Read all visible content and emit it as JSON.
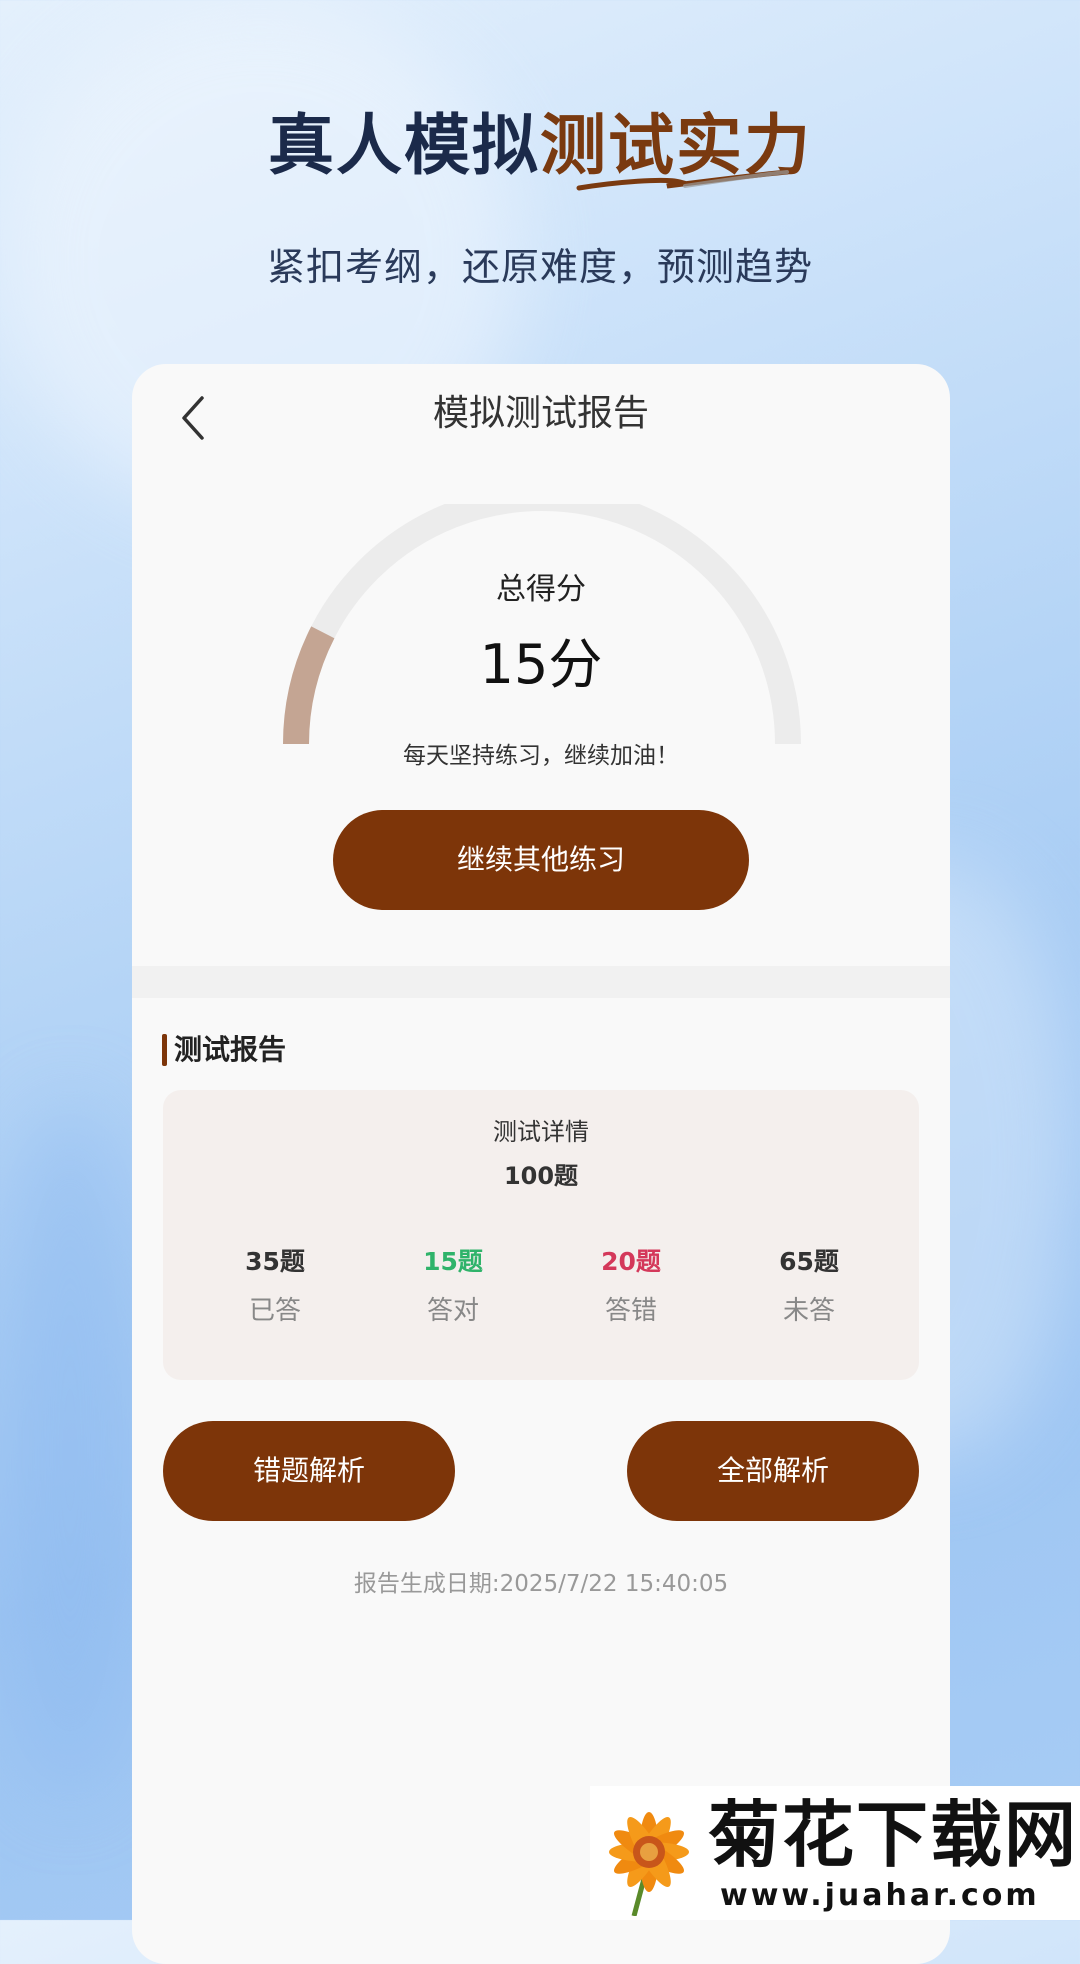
{
  "hero": {
    "title_part1": "真人模拟",
    "title_part2": "测试实力",
    "subtitle": "紧扣考纲，还原难度，预测趋势"
  },
  "nav": {
    "title": "模拟测试报告"
  },
  "score": {
    "label": "总得分",
    "value": "15分",
    "encourage": "每天坚持练习，继续加油！",
    "fraction": 0.15
  },
  "buttons": {
    "continue": "继续其他练习",
    "wrong_analysis": "错题解析",
    "all_analysis": "全部解析"
  },
  "report": {
    "section_title": "测试报告",
    "detail_label": "测试详情",
    "total": "100题",
    "stats": [
      {
        "value": "35题",
        "label": "已答",
        "color": "#333333"
      },
      {
        "value": "15题",
        "label": "答对",
        "color": "#2fb36a"
      },
      {
        "value": "20题",
        "label": "答错",
        "color": "#d4385a"
      },
      {
        "value": "65题",
        "label": "未答",
        "color": "#333333"
      }
    ],
    "date": "报告生成日期:2025/7/22 15:40:05"
  },
  "watermark": {
    "name": "菊花下载网",
    "url": "www.juahar.com"
  },
  "colors": {
    "accent": "#7d3509",
    "gauge_track": "#ececec",
    "gauge_fill": "#c4a593"
  }
}
